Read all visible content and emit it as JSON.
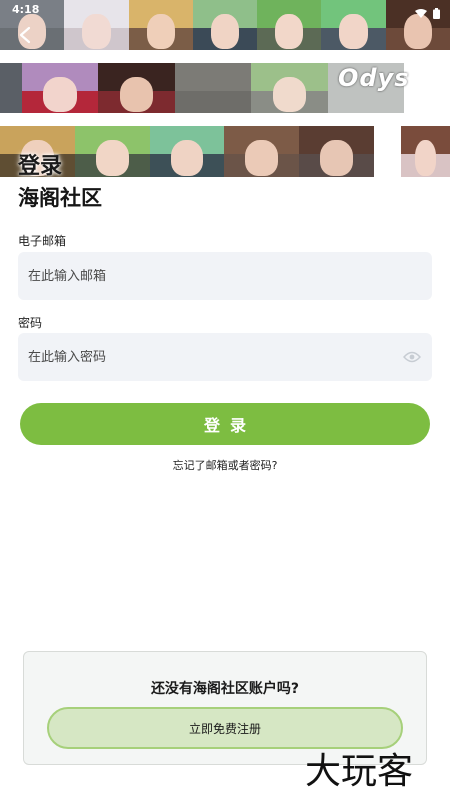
{
  "status_bar": {
    "time": "4:18"
  },
  "banner": {
    "logo_text": "Odys",
    "heading": "登录"
  },
  "form": {
    "community_title": "海阁社区",
    "email_label": "电子邮箱",
    "email_placeholder": "在此输入邮箱",
    "password_label": "密码",
    "password_placeholder": "在此输入密码",
    "login_button": "登录",
    "forgot_link": "忘记了邮箱或者密码?"
  },
  "register": {
    "question": "还没有海阁社区账户吗?",
    "button": "立即免费注册"
  },
  "watermark": "大玩客",
  "colors": {
    "accent": "#7dbd41",
    "field_bg": "#f1f3f7",
    "register_btn_bg": "#d6e7c4",
    "register_btn_border": "#a6d07a"
  },
  "icons": [
    "back-arrow-icon",
    "wifi-icon",
    "battery-icon",
    "eye-icon"
  ]
}
